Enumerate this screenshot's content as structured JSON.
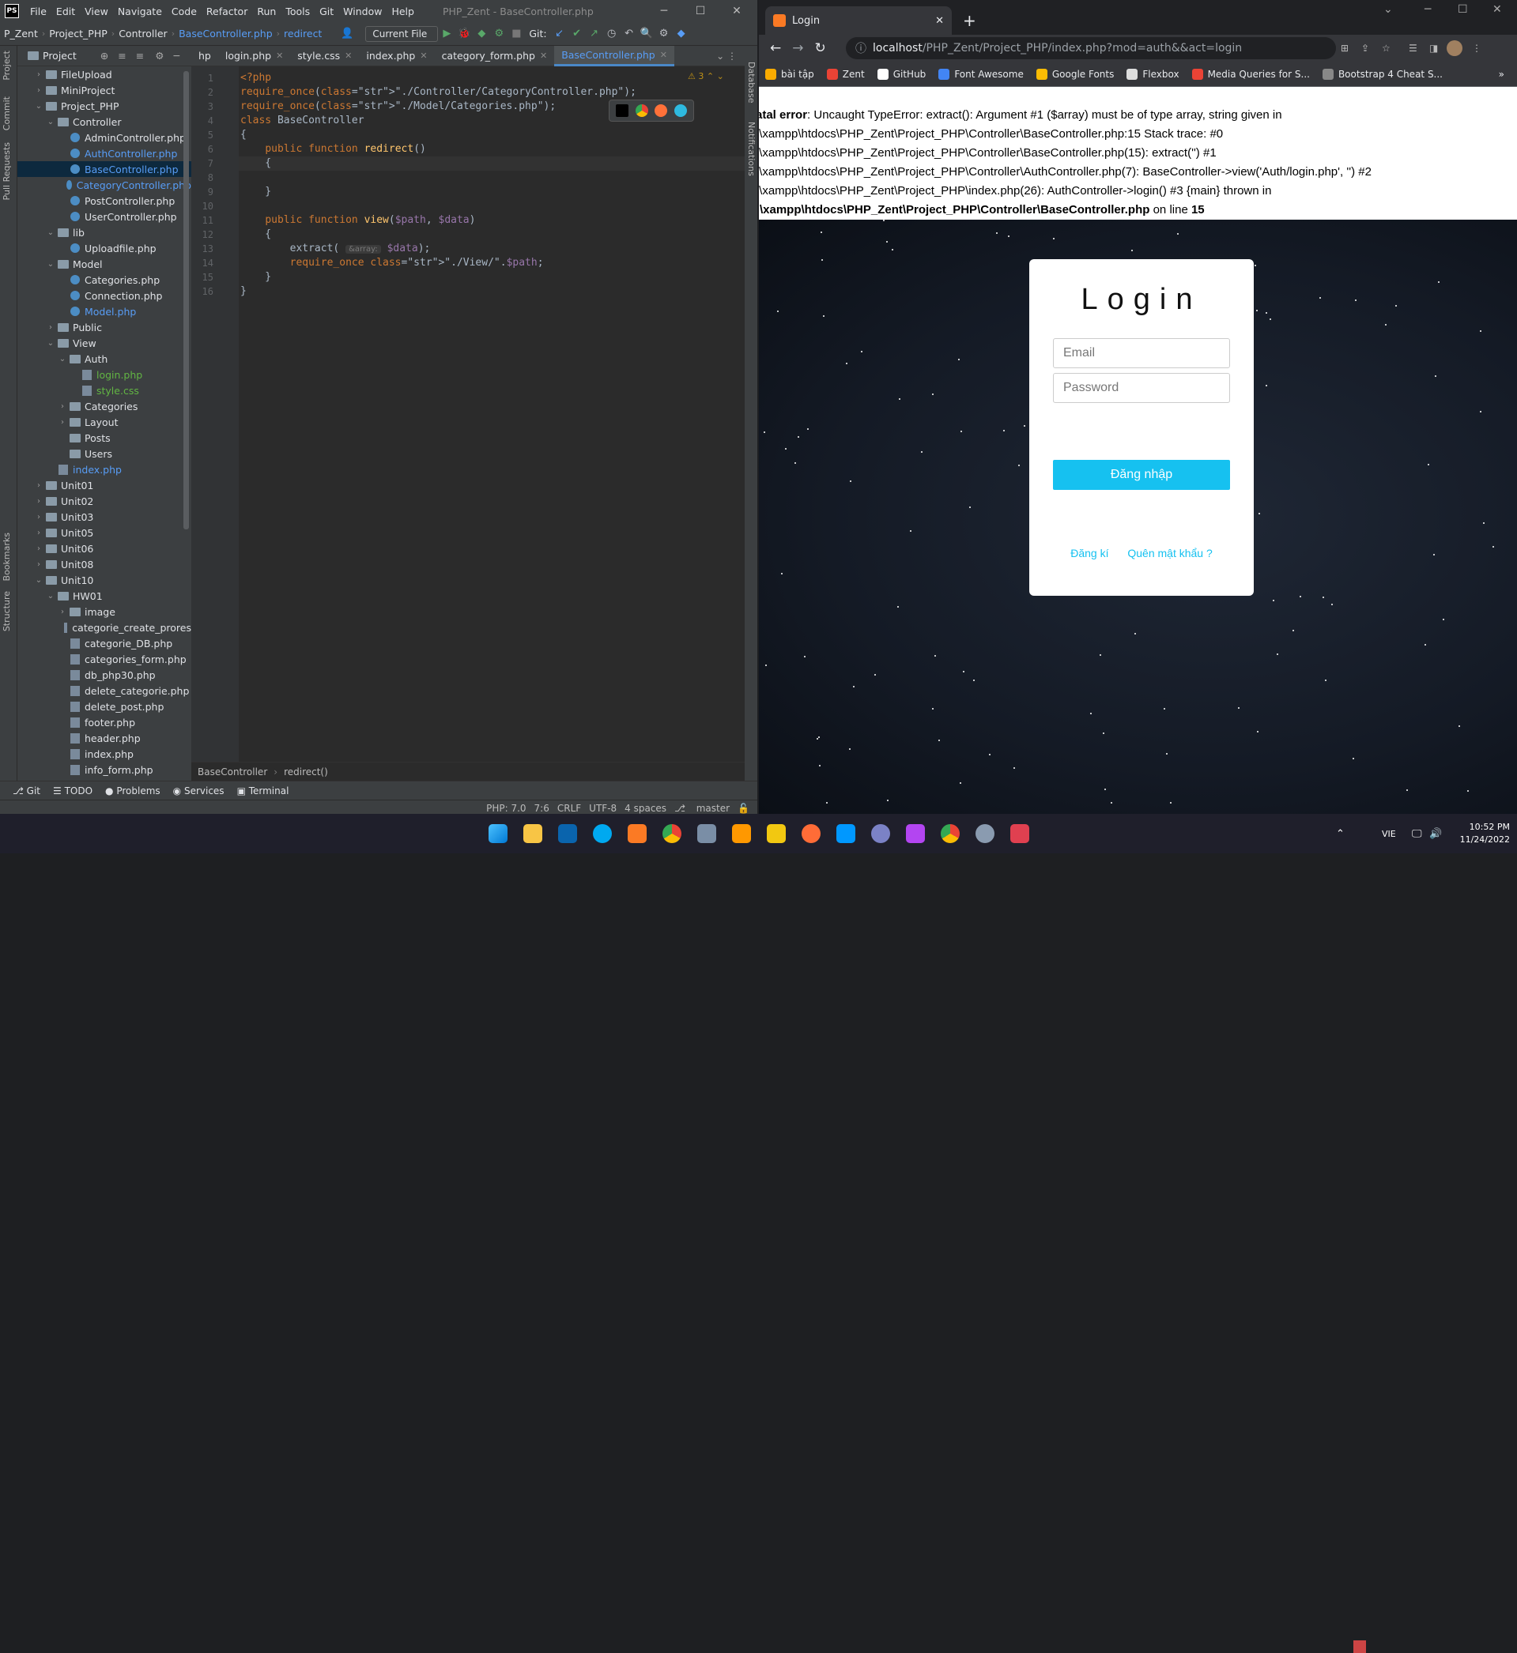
{
  "ide": {
    "window_title": "PHP_Zent - BaseController.php",
    "menu": [
      "File",
      "Edit",
      "View",
      "Navigate",
      "Code",
      "Refactor",
      "Run",
      "Tools",
      "Git",
      "Window",
      "Help"
    ],
    "breadcrumbs": [
      "P_Zent",
      "Project_PHP",
      "Controller",
      "BaseController.php",
      "redirect"
    ],
    "run_config": "Current File",
    "git_label": "Git:",
    "project_panel_title": "Project",
    "tree": [
      {
        "label": "FileUpload",
        "type": "folder",
        "depth": 1,
        "open": false
      },
      {
        "label": "MiniProject",
        "type": "folder",
        "depth": 1,
        "open": false
      },
      {
        "label": "Project_PHP",
        "type": "folder",
        "depth": 1,
        "open": true
      },
      {
        "label": "Controller",
        "type": "folder",
        "depth": 2,
        "open": true
      },
      {
        "label": "AdminController.php",
        "type": "php",
        "depth": 3
      },
      {
        "label": "AuthController.php",
        "type": "php",
        "depth": 3,
        "color": "blue"
      },
      {
        "label": "BaseController.php",
        "type": "php",
        "depth": 3,
        "color": "blue",
        "selected": true
      },
      {
        "label": "CategoryController.php",
        "type": "php",
        "depth": 3,
        "color": "blue"
      },
      {
        "label": "PostController.php",
        "type": "php",
        "depth": 3
      },
      {
        "label": "UserController.php",
        "type": "php",
        "depth": 3
      },
      {
        "label": "lib",
        "type": "folder",
        "depth": 2,
        "open": true
      },
      {
        "label": "Uploadfile.php",
        "type": "php",
        "depth": 3
      },
      {
        "label": "Model",
        "type": "folder",
        "depth": 2,
        "open": true
      },
      {
        "label": "Categories.php",
        "type": "php",
        "depth": 3
      },
      {
        "label": "Connection.php",
        "type": "php",
        "depth": 3
      },
      {
        "label": "Model.php",
        "type": "php",
        "depth": 3,
        "color": "blue"
      },
      {
        "label": "Public",
        "type": "folder",
        "depth": 2,
        "open": false
      },
      {
        "label": "View",
        "type": "folder",
        "depth": 2,
        "open": true
      },
      {
        "label": "Auth",
        "type": "folder",
        "depth": 3,
        "open": true
      },
      {
        "label": "login.php",
        "type": "file",
        "depth": 4,
        "color": "green"
      },
      {
        "label": "style.css",
        "type": "file",
        "depth": 4,
        "color": "green"
      },
      {
        "label": "Categories",
        "type": "folder",
        "depth": 3,
        "open": false
      },
      {
        "label": "Layout",
        "type": "folder",
        "depth": 3,
        "open": false
      },
      {
        "label": "Posts",
        "type": "folder",
        "depth": 3
      },
      {
        "label": "Users",
        "type": "folder",
        "depth": 3
      },
      {
        "label": "index.php",
        "type": "file",
        "depth": 2,
        "color": "blue"
      },
      {
        "label": "Unit01",
        "type": "folder",
        "depth": 1,
        "open": false
      },
      {
        "label": "Unit02",
        "type": "folder",
        "depth": 1,
        "open": false
      },
      {
        "label": "Unit03",
        "type": "folder",
        "depth": 1,
        "open": false
      },
      {
        "label": "Unit05",
        "type": "folder",
        "depth": 1,
        "open": false
      },
      {
        "label": "Unit06",
        "type": "folder",
        "depth": 1,
        "open": false
      },
      {
        "label": "Unit08",
        "type": "folder",
        "depth": 1,
        "open": false
      },
      {
        "label": "Unit10",
        "type": "folder",
        "depth": 1,
        "open": true
      },
      {
        "label": "HW01",
        "type": "folder",
        "depth": 2,
        "open": true
      },
      {
        "label": "image",
        "type": "folder",
        "depth": 3,
        "open": false
      },
      {
        "label": "categorie_create_prores",
        "type": "file",
        "depth": 3
      },
      {
        "label": "categorie_DB.php",
        "type": "file",
        "depth": 3
      },
      {
        "label": "categories_form.php",
        "type": "file",
        "depth": 3
      },
      {
        "label": "db_php30.php",
        "type": "file",
        "depth": 3
      },
      {
        "label": "delete_categorie.php",
        "type": "file",
        "depth": 3
      },
      {
        "label": "delete_post.php",
        "type": "file",
        "depth": 3
      },
      {
        "label": "footer.php",
        "type": "file",
        "depth": 3
      },
      {
        "label": "header.php",
        "type": "file",
        "depth": 3
      },
      {
        "label": "index.php",
        "type": "file",
        "depth": 3
      },
      {
        "label": "info_form.php",
        "type": "file",
        "depth": 3
      }
    ],
    "tabs": [
      "hp",
      "login.php",
      "style.css",
      "index.php",
      "category_form.php",
      "BaseController.php"
    ],
    "active_tab": "BaseController.php",
    "warning_count": "3",
    "param_hint": "&array:",
    "code": [
      "<?php",
      "require_once(\"./Controller/CategoryController.php\");",
      "require_once(\"./Model/Categories.php\");",
      "class BaseController",
      "{",
      "    public function redirect()",
      "    {",
      "",
      "    }",
      "",
      "    public function view($path, $data)",
      "    {",
      "        extract( $data);",
      "        require_once \"./View/\".$path;",
      "    }",
      "}"
    ],
    "bottom_breadcrumb": [
      "BaseController",
      "redirect()"
    ],
    "tool_tabs": [
      "Git",
      "TODO",
      "Problems",
      "Services",
      "Terminal"
    ],
    "left_strip": [
      "Project",
      "Commit",
      "Pull Requests",
      "Bookmarks",
      "Structure"
    ],
    "right_strip": [
      "Database",
      "Notifications"
    ],
    "status": [
      "PHP: 7.0",
      "7:6",
      "CRLF",
      "UTF-8",
      "4 spaces",
      "master"
    ]
  },
  "browser": {
    "tab_title": "Login",
    "url_host": "localhost",
    "url_path": "/PHP_Zent/Project_PHP/index.php?mod=auth&&act=login",
    "bookmarks": [
      {
        "label": "bài tập",
        "color": "#f9ab00"
      },
      {
        "label": "Zent",
        "color": "#ea4335"
      },
      {
        "label": "GitHub",
        "color": "#ffffff"
      },
      {
        "label": "Font Awesome",
        "color": "#4285f4"
      },
      {
        "label": "Google Fonts",
        "color": "#fbbc04"
      },
      {
        "label": "Flexbox",
        "color": "#dddddd"
      },
      {
        "label": "Media Queries for S...",
        "color": "#ea4335"
      },
      {
        "label": "Bootstrap 4 Cheat S...",
        "color": "#888888"
      }
    ],
    "error": {
      "line1_bold": "atal error",
      "line1": ": Uncaught TypeError: extract(): Argument #1 ($array) must be of type array, string given in",
      "line2": ":\\xampp\\htdocs\\PHP_Zent\\Project_PHP\\Controller\\BaseController.php:15 Stack trace: #0",
      "line3": ":\\xampp\\htdocs\\PHP_Zent\\Project_PHP\\Controller\\BaseController.php(15): extract('') #1",
      "line4": ":\\xampp\\htdocs\\PHP_Zent\\Project_PHP\\Controller\\AuthController.php(7): BaseController->view('Auth/login.php', '') #2",
      "line5": ":\\xampp\\htdocs\\PHP_Zent\\Project_PHP\\index.php(26): AuthController->login() #3 {main} thrown in",
      "line6_bold": ":\\xampp\\htdocs\\PHP_Zent\\Project_PHP\\Controller\\BaseController.php",
      "line6_mid": " on line ",
      "line6_num": "15"
    },
    "login": {
      "title": "Login",
      "email_placeholder": "Email",
      "password_placeholder": "Password",
      "submit": "Đăng nhập",
      "register": "Đăng kí",
      "forgot": "Quên mật khẩu ?"
    }
  },
  "taskbar": {
    "lang": "VIE",
    "time": "10:52 PM",
    "date": "11/24/2022"
  }
}
